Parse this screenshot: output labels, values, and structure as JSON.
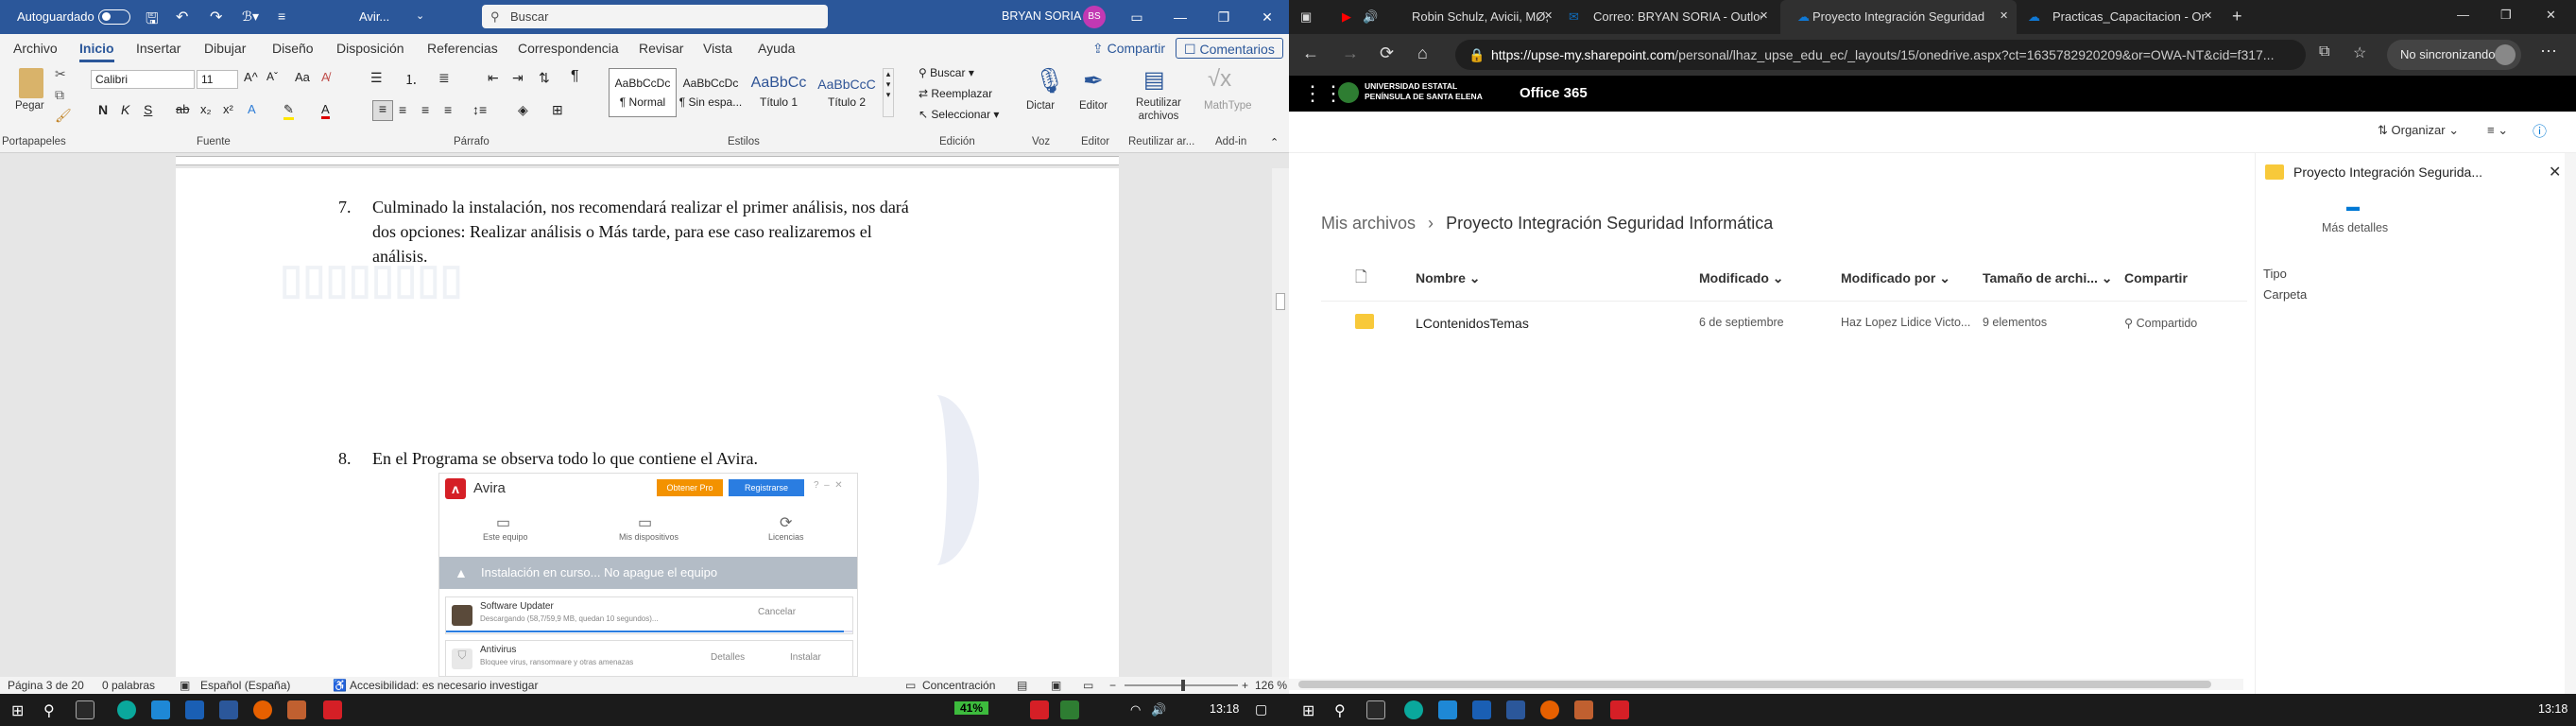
{
  "word": {
    "autosave_label": "Autoguardado",
    "doc_title": "Avir...",
    "search_placeholder": "Buscar",
    "user_name": "BRYAN SORIA",
    "user_initials": "BS",
    "tabs": [
      "Archivo",
      "Inicio",
      "Insertar",
      "Dibujar",
      "Diseño",
      "Disposición",
      "Referencias",
      "Correspondencia",
      "Revisar",
      "Vista",
      "Ayuda"
    ],
    "share_label": "Compartir",
    "comments_label": "Comentarios",
    "ribbon": {
      "paste_label": "Pegar",
      "font_name": "Calibri",
      "font_size": "11",
      "styles": [
        {
          "preview": "AaBbCcDc",
          "name": "¶ Normal"
        },
        {
          "preview": "AaBbCcDc",
          "name": "¶ Sin espa..."
        },
        {
          "preview": "AaBbCc",
          "name": "Título 1"
        },
        {
          "preview": "AaBbCcC",
          "name": "Título 2"
        }
      ],
      "find_label": "Buscar",
      "replace_label": "Reemplazar",
      "select_label": "Seleccionar",
      "dictate_label": "Dictar",
      "editor_label": "Editor",
      "reuse_label": "Reutilizar archivos",
      "mathtype_label": "MathType",
      "groups": [
        "Portapapeles",
        "Fuente",
        "Párrafo",
        "Estilos",
        "Edición",
        "Voz",
        "Editor",
        "Reutilizar ar...",
        "Add-in"
      ]
    },
    "document": {
      "item7_num": "7.",
      "item7_line1": "Culminado la instalación, nos recomendará realizar el primer análisis, nos dará",
      "item7_line2": "dos opciones: Realizar análisis o Más tarde, para ese caso realizaremos el",
      "item7_line3": "análisis.",
      "item8_num": "8.",
      "item8_text": "En el Programa se observa todo lo que contiene el Avira."
    },
    "avira": {
      "title": "Avira",
      "btn_obtain": "Obtener Pro",
      "btn_register": "Registrarse",
      "nav": [
        "Este equipo",
        "Mis dispositivos",
        "Licencias"
      ],
      "banner": "Instalación en curso... No apague el equipo",
      "row1_title": "Software Updater",
      "row1_sub": "Descargando (58,7/59,9 MB, quedan 10 segundos)...",
      "row1_action": "Cancelar",
      "row1_progress": 0.98,
      "row2_title": "Antivirus",
      "row2_sub": "Bloquee virus, ransomware y otras amenazas",
      "row2_details": "Detalles",
      "row2_action": "Instalar"
    },
    "status": {
      "page": "Página 3 de 20",
      "words": "0 palabras",
      "language": "Español (España)",
      "accessibility": "Accesibilidad: es necesario investigar",
      "focus": "Concentración",
      "zoom": "126 %"
    }
  },
  "browser": {
    "tabs": [
      {
        "label": "Robin Schulz, Avicii, MØ, Av...",
        "color": "#ff0000"
      },
      {
        "label": "Correo: BRYAN SORIA - Outlook",
        "color": "#0f6cbd"
      },
      {
        "label": "Proyecto Integración Seguridad",
        "color": "#0f78d4",
        "active": true
      },
      {
        "label": "Practicas_Capacitacion - OneDri...",
        "color": "#0f78d4"
      }
    ],
    "url_domain": "https://upse-my.sharepoint.com",
    "url_path": "/personal/lhaz_upse_edu_ec/_layouts/15/onedrive.aspx?ct=1635782920209&or=OWA-NT&cid=f317...",
    "sync_label": "No sincronizando",
    "org_line1": "UNIVERSIDAD ESTATAL",
    "org_line2": "PENÍNSULA DE SANTA ELENA",
    "o365_label": "Office 365",
    "organize_label": "Organizar",
    "breadcrumb_root": "Mis archivos",
    "breadcrumb_current": "Proyecto Integración Seguridad Informática",
    "columns": [
      "Nombre",
      "Modificado",
      "Modificado por",
      "Tamaño de archi...",
      "Compartir"
    ],
    "rows": [
      {
        "name": "LContenidosTemas",
        "modified": "6 de septiembre",
        "modified_by": "Haz Lopez Lidice Victo...",
        "size": "9 elementos",
        "sharing": "Compartido"
      }
    ],
    "pane": {
      "title": "Proyecto Integración Segurida...",
      "more_details": "Más detalles",
      "type_label": "Tipo",
      "type_value": "Carpeta"
    }
  },
  "taskbar": {
    "battery": "41%",
    "time_left": "13:18",
    "time_right": "13:18"
  }
}
